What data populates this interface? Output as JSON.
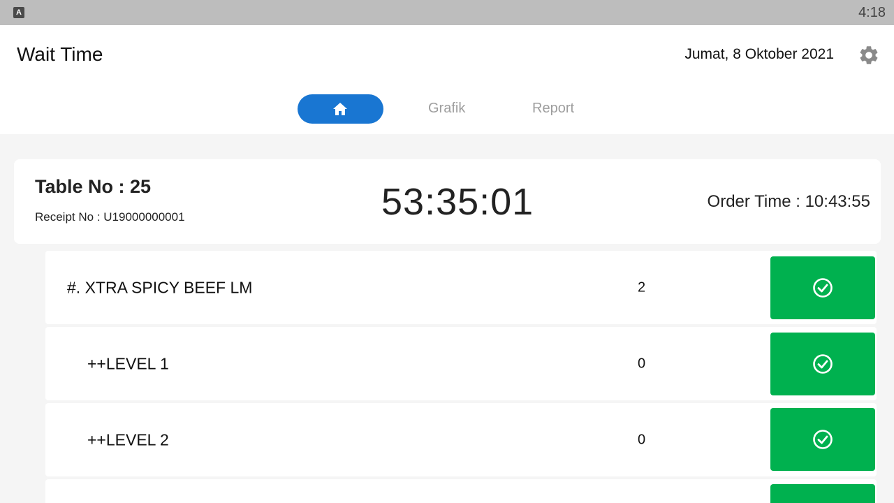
{
  "status_bar": {
    "app_icon_letter": "A",
    "time": "4:18"
  },
  "header": {
    "title": "Wait Time",
    "date": "Jumat, 8 Oktober 2021",
    "settings_icon": "gear-icon"
  },
  "tabs": {
    "home_icon": "home-icon",
    "active": "home",
    "grafik": "Grafik",
    "report": "Report"
  },
  "order": {
    "table_no": "Table No : 25",
    "receipt_no": "Receipt No : U19000000001",
    "elapsed": "53:35:01",
    "order_time": "Order Time : 10:43:55"
  },
  "items": [
    {
      "name": "#. XTRA SPICY BEEF LM",
      "qty": "2"
    },
    {
      "name": "++LEVEL 1",
      "qty": "0"
    },
    {
      "name": "++LEVEL 2",
      "qty": "0"
    }
  ],
  "colors": {
    "accent": "#1976d2",
    "done": "#00b14f",
    "status_bar": "#bdbdbd",
    "background": "#f5f5f5"
  }
}
